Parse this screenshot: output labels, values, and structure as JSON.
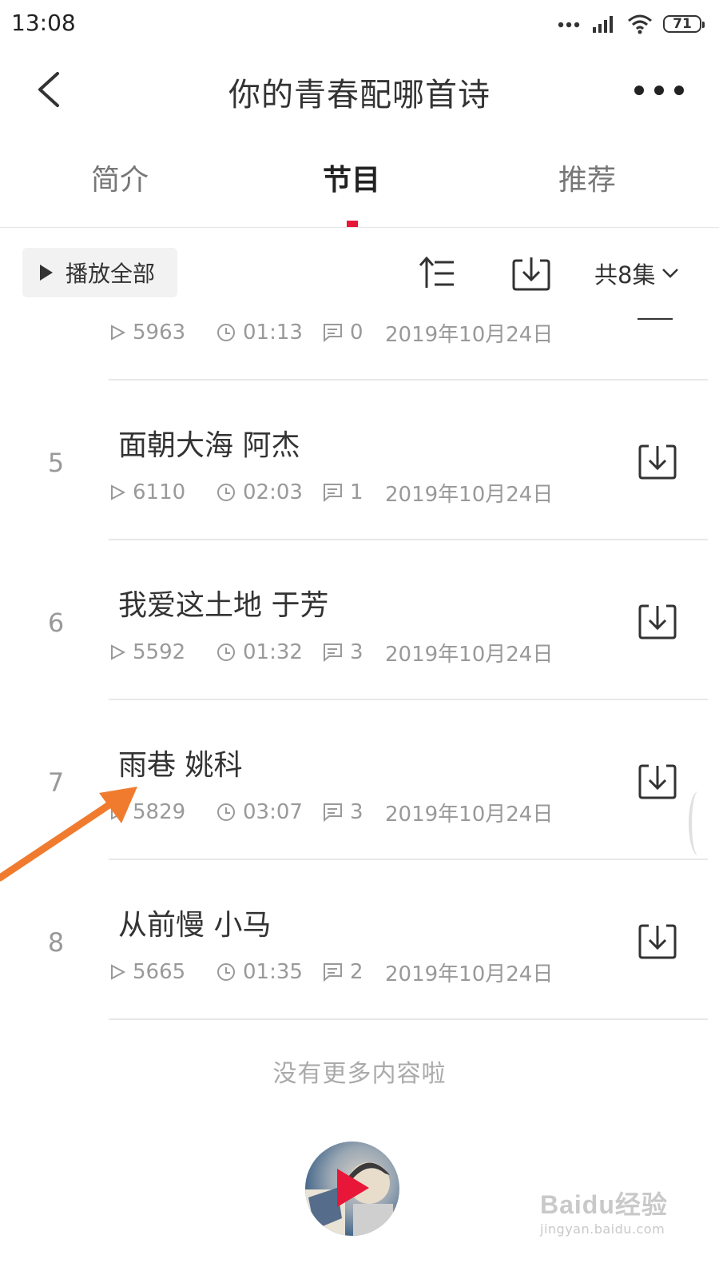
{
  "status_bar": {
    "time": "13:08",
    "battery": "71"
  },
  "header": {
    "title": "你的青春配哪首诗"
  },
  "tabs": [
    {
      "label": "简介",
      "active": false
    },
    {
      "label": "节目",
      "active": true
    },
    {
      "label": "推荐",
      "active": false
    }
  ],
  "toolbar": {
    "play_all_label": "播放全部",
    "episode_count": "共8集"
  },
  "partial_episode": {
    "plays": "5963",
    "duration": "01:13",
    "comments": "0",
    "date": "2019年10月24日"
  },
  "episodes": [
    {
      "index": "5",
      "title": "面朝大海 阿杰",
      "plays": "6110",
      "duration": "02:03",
      "comments": "1",
      "date": "2019年10月24日"
    },
    {
      "index": "6",
      "title": "我爱这土地 于芳",
      "plays": "5592",
      "duration": "01:32",
      "comments": "3",
      "date": "2019年10月24日"
    },
    {
      "index": "7",
      "title": "雨巷 姚科",
      "plays": "5829",
      "duration": "03:07",
      "comments": "3",
      "date": "2019年10月24日"
    },
    {
      "index": "8",
      "title": "从前慢 小马",
      "plays": "5665",
      "duration": "01:35",
      "comments": "2",
      "date": "2019年10月24日"
    }
  ],
  "list_end_text": "没有更多内容啦",
  "watermark": {
    "brand": "Baidu经验",
    "url": "jingyan.baidu.com"
  },
  "colors": {
    "accent": "#e8173a",
    "annotation_arrow": "#f07b2e",
    "muted_text": "#999999"
  },
  "icons": {
    "back": "chevron-left-icon",
    "more": "more-dots-icon",
    "play": "play-icon",
    "sort": "sort-icon",
    "download": "download-icon",
    "chevron": "chevron-down-icon",
    "plays": "play-count-icon",
    "duration": "clock-icon",
    "comments": "comment-icon"
  }
}
